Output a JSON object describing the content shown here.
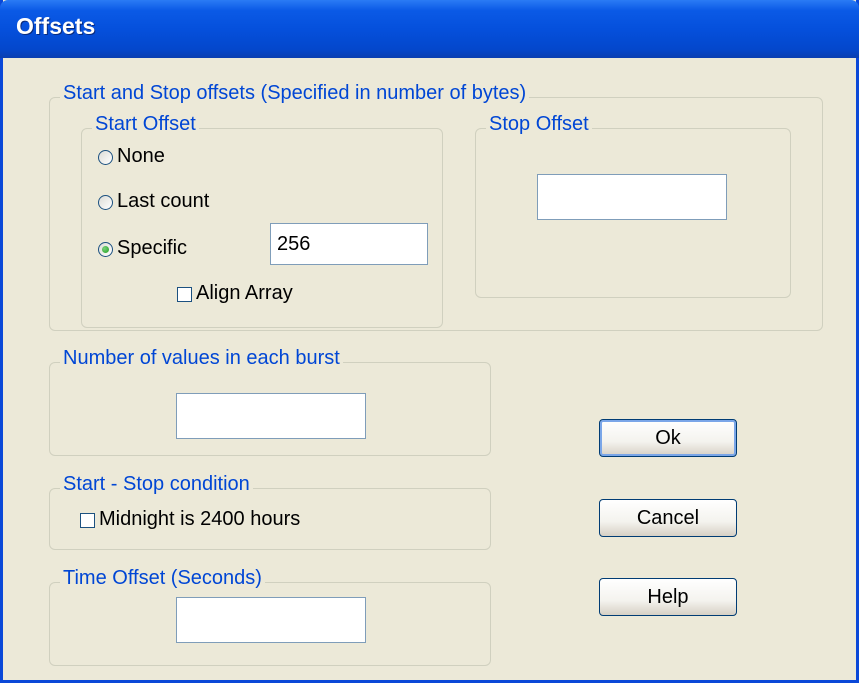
{
  "window": {
    "title": "Offsets"
  },
  "offsets_group": {
    "legend": "Start and Stop offsets (Specified in number of bytes)",
    "start": {
      "legend": "Start Offset",
      "options": [
        {
          "label": "None",
          "selected": false
        },
        {
          "label": "Last count",
          "selected": false
        },
        {
          "label": "Specific",
          "selected": true
        }
      ],
      "specific_value": "256",
      "align_array": {
        "label": "Align Array",
        "checked": false
      }
    },
    "stop": {
      "legend": "Stop Offset",
      "value": ""
    }
  },
  "burst": {
    "legend": "Number of values in each burst",
    "value": ""
  },
  "condition": {
    "legend": "Start - Stop condition",
    "midnight": {
      "label": "Midnight is 2400 hours",
      "checked": false
    }
  },
  "time_offset": {
    "legend": "Time Offset (Seconds)",
    "value": ""
  },
  "buttons": {
    "ok": "Ok",
    "cancel": "Cancel",
    "help": "Help"
  },
  "colors": {
    "title_bar": "#0550dc",
    "dialog_bg": "#ece9d8",
    "legend_text": "#0046d5"
  }
}
